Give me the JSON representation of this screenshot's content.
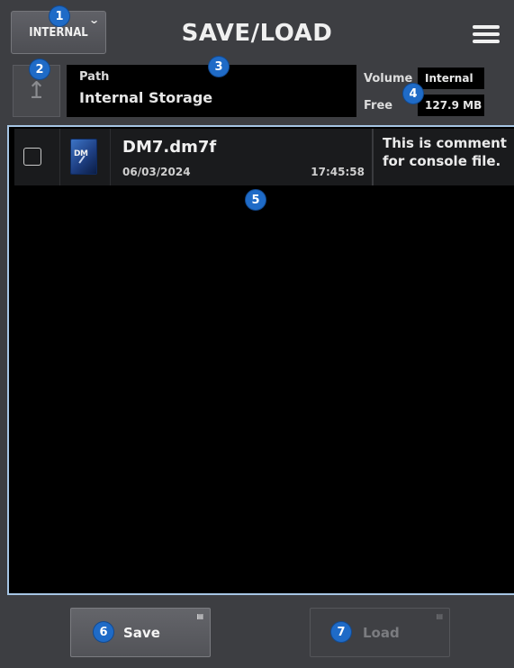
{
  "header": {
    "volume_button": "INTERNAL",
    "title": "SAVE/LOAD"
  },
  "info": {
    "path_label": "Path",
    "path_value": "Internal Storage",
    "volume_label": "Volume",
    "volume_value": "Internal",
    "free_label": "Free",
    "free_value": "127.9 MB"
  },
  "files": [
    {
      "name": "DM7.dm7f",
      "date": "06/03/2024",
      "time": "17:45:58",
      "comment": "This is comment for console file.",
      "icon_text": "DM",
      "checked": false
    }
  ],
  "footer": {
    "save_label": "Save",
    "load_label": "Load"
  },
  "callouts": [
    "1",
    "2",
    "3",
    "4",
    "5",
    "6",
    "7"
  ],
  "colors": {
    "background": "#3d3e42",
    "list_border": "#a6c5e4",
    "callout": "#1f6bc7"
  }
}
